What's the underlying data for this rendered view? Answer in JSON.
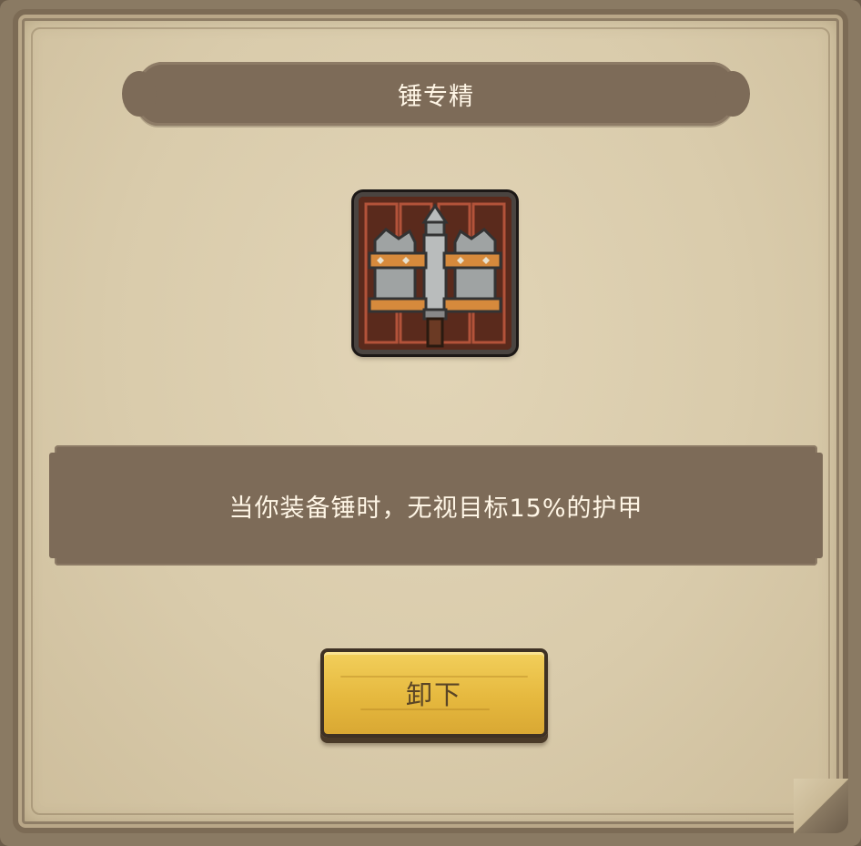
{
  "dialog": {
    "title": "锤专精",
    "description": "当你装备锤时，无视目标15%的护甲",
    "button_label": "卸下"
  },
  "skill_icon": {
    "name": "hammer-mastery-icon"
  },
  "colors": {
    "panel_background": "#d9cbab",
    "banner": "#7d6b58",
    "button": "#e6b93f",
    "text_light": "#fff6e6",
    "text_button": "#5a4526"
  }
}
